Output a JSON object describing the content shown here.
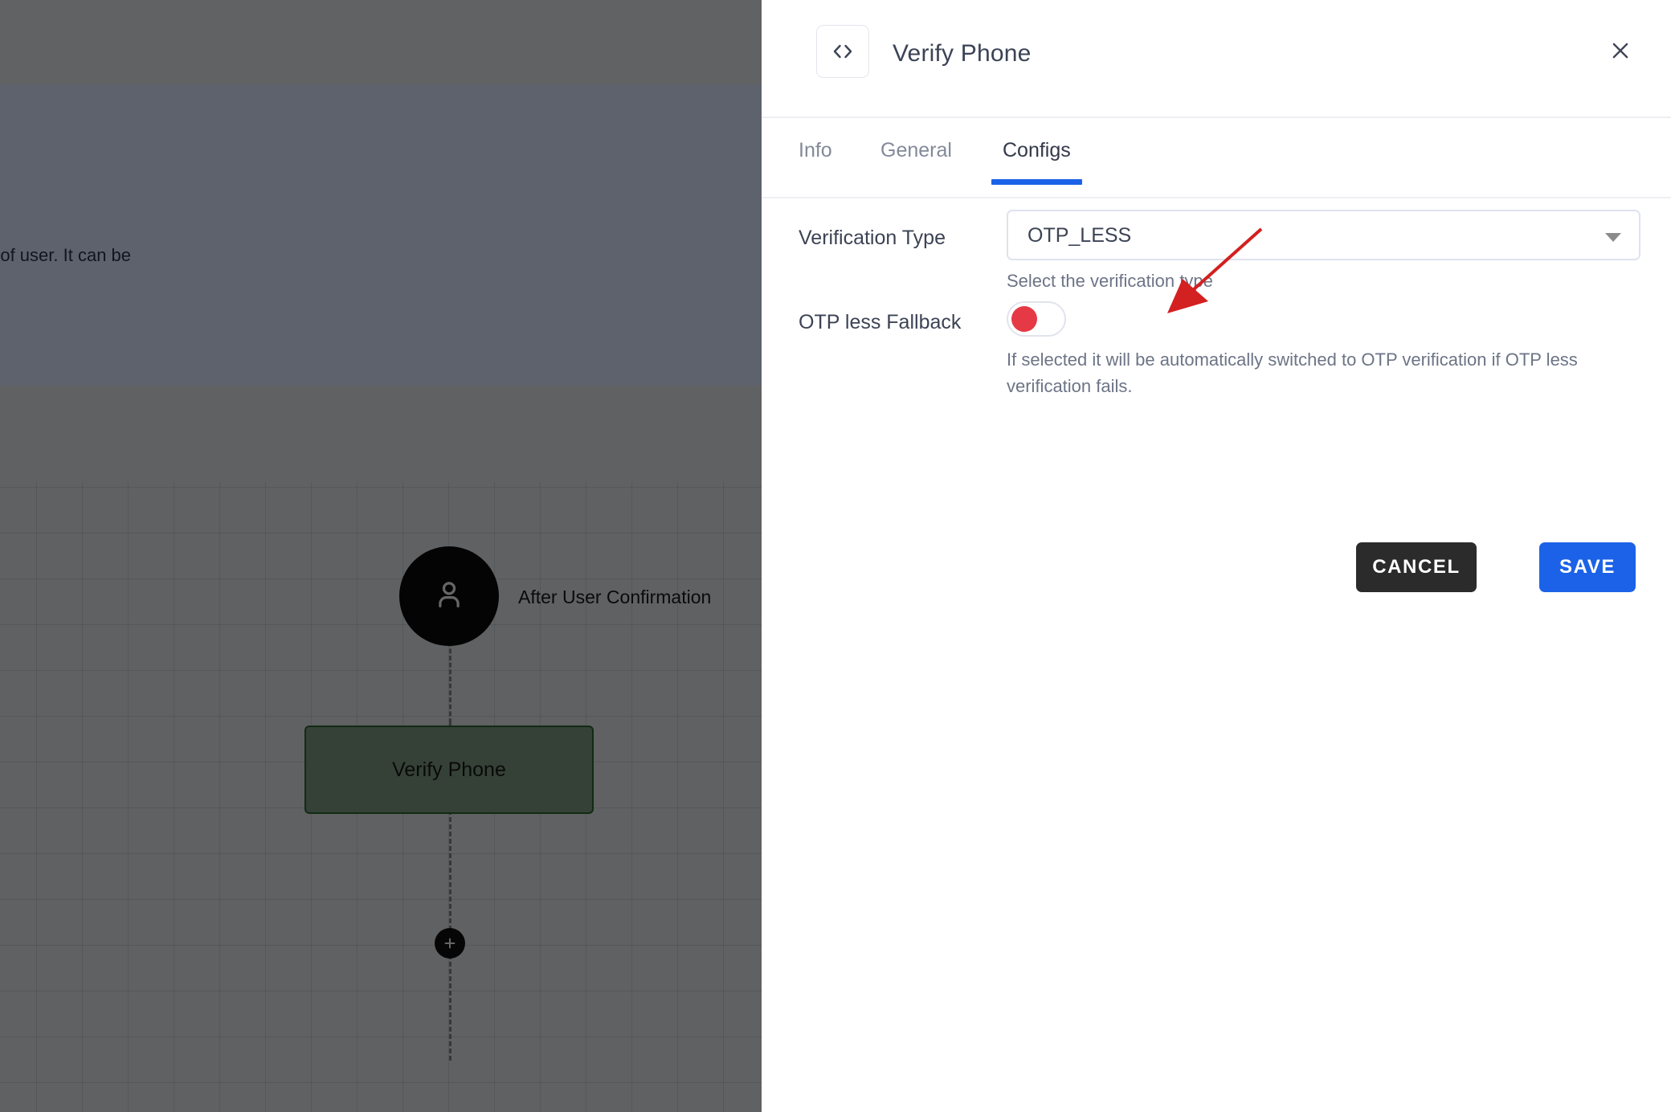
{
  "background": {
    "partial_text": "n of user. It can be",
    "flow": {
      "start_node_label": "After User Confirmation",
      "start_node_icon": "user-icon",
      "task_node_label": "Verify Phone",
      "add_node_icon": "plus-icon"
    }
  },
  "panel": {
    "icon": "code-brackets-icon",
    "title": "Verify Phone",
    "close_icon": "close-icon",
    "tabs": [
      {
        "label": "Info",
        "active": false
      },
      {
        "label": "General",
        "active": false
      },
      {
        "label": "Configs",
        "active": true
      }
    ],
    "form": {
      "verification_type": {
        "label": "Verification Type",
        "value": "OTP_LESS",
        "helper": "Select the verification type",
        "caret_icon": "chevron-down-icon"
      },
      "otp_less_fallback": {
        "label": "OTP less Fallback",
        "state": "off",
        "helper": "If selected it will be automatically switched to OTP verification if OTP less verification fails."
      }
    },
    "actions": {
      "cancel_label": "CANCEL",
      "save_label": "SAVE"
    }
  },
  "annotation": {
    "type": "arrow",
    "color": "#d32020"
  },
  "colors": {
    "accent_blue": "#1b62e8",
    "cancel_dark": "#2b2b2b",
    "toggle_off_red": "#e63946",
    "node_green_fill": "#86a287",
    "node_green_border": "#2f6b33",
    "annotation_red": "#d32020"
  }
}
